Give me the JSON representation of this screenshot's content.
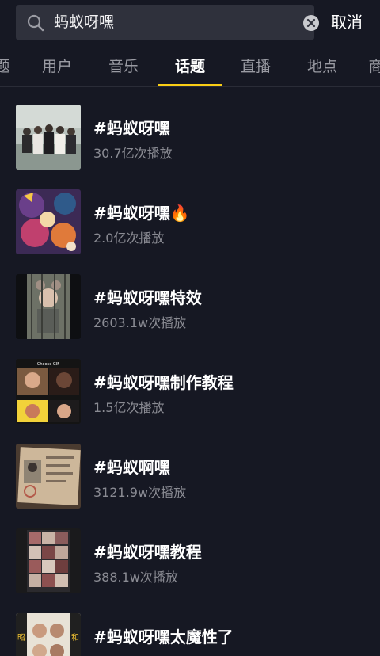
{
  "search": {
    "query": "蚂蚁呀嘿",
    "cancel_label": "取消"
  },
  "tabs": [
    {
      "label": "题"
    },
    {
      "label": "用户"
    },
    {
      "label": "音乐"
    },
    {
      "label": "话题"
    },
    {
      "label": "直播"
    },
    {
      "label": "地点"
    },
    {
      "label": "商"
    }
  ],
  "active_tab": "话题",
  "accent_color": "#face15",
  "results": [
    {
      "title": "#蚂蚁呀嘿",
      "plays": "30.7亿次播放"
    },
    {
      "title": "#蚂蚁呀嘿🔥",
      "plays": "2.0亿次播放"
    },
    {
      "title": "#蚂蚁呀嘿特效",
      "plays": "2603.1w次播放"
    },
    {
      "title": "#蚂蚁呀嘿制作教程",
      "plays": "1.5亿次播放"
    },
    {
      "title": "#蚂蚁啊嘿",
      "plays": "3121.9w次播放"
    },
    {
      "title": "#蚂蚁呀嘿教程",
      "plays": "388.1w次播放"
    },
    {
      "title": "#蚂蚁呀嘿太魔性了",
      "plays": ""
    }
  ],
  "thumb_texts": {
    "thumb4_header": "Choose GIF",
    "thumb7_left": "昭",
    "thumb7_right": "和"
  }
}
